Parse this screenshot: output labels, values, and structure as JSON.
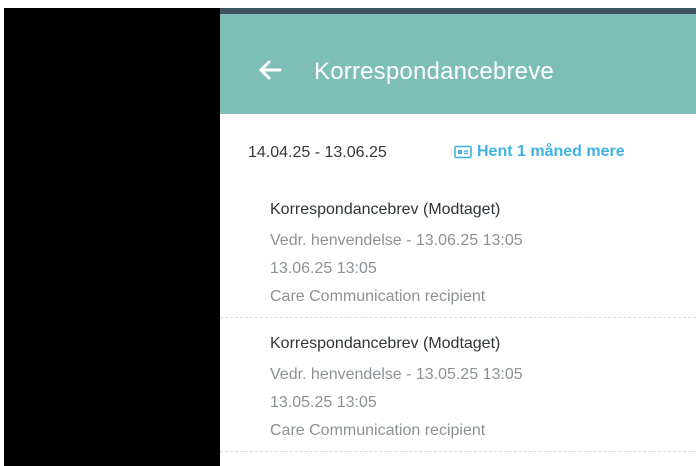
{
  "app_bar": {
    "title": "Korrespondancebreve",
    "back_icon": "arrow-left-icon"
  },
  "period": {
    "date_range": "14.04.25 - 13.06.25",
    "load_more_label": "Hent 1 måned mere",
    "load_more_icon": "calendar-icon"
  },
  "letters": [
    {
      "title": "Korrespondancebrev (Modtaget)",
      "subject": "Vedr. henvendelse - 13.06.25 13:05",
      "date": "13.06.25 13:05",
      "recipient": "Care Communication recipient"
    },
    {
      "title": "Korrespondancebrev (Modtaget)",
      "subject": "Vedr. henvendelse - 13.05.25 13:05",
      "date": "13.05.25 13:05",
      "recipient": "Care Communication recipient"
    }
  ],
  "colors": {
    "app_bar": "#7dbfb6",
    "accent": "#3fb3e3",
    "status_strip": "#3d5560"
  }
}
